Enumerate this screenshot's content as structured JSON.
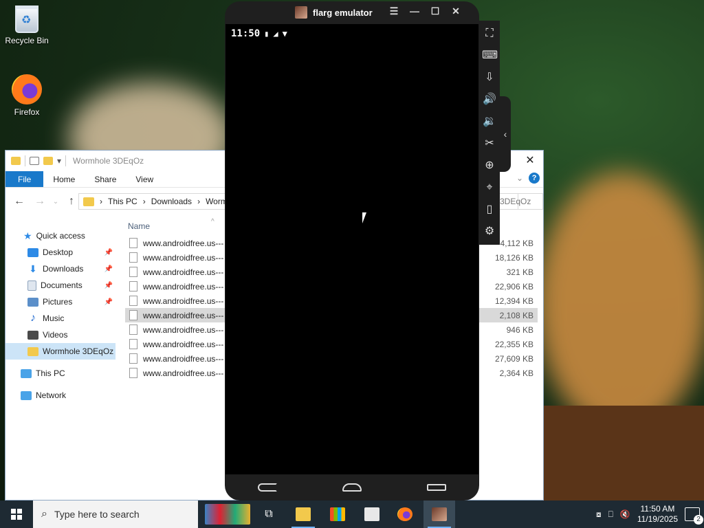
{
  "desktop": {
    "icons": [
      {
        "label": "Recycle Bin",
        "icon": "recycle-bin-icon"
      },
      {
        "label": "Firefox",
        "icon": "firefox-icon"
      }
    ]
  },
  "explorer": {
    "title": "Wormhole 3DEqOz",
    "ribbon_tabs": [
      "File",
      "Home",
      "Share",
      "View"
    ],
    "path": [
      "This PC",
      "Downloads",
      "Worm"
    ],
    "search_placeholder": "3DEqOz",
    "column_name": "Name",
    "nav": {
      "quick_access": "Quick access",
      "items": [
        {
          "label": "Desktop",
          "pinned": true,
          "color": "#2d8ae6"
        },
        {
          "label": "Downloads",
          "pinned": true,
          "color": "#2d8ae6"
        },
        {
          "label": "Documents",
          "pinned": true,
          "color": "#8da3bd"
        },
        {
          "label": "Pictures",
          "pinned": true,
          "color": "#5b8fc9"
        },
        {
          "label": "Music",
          "pinned": false,
          "color": "#2d72d2"
        },
        {
          "label": "Videos",
          "pinned": false,
          "color": "#4a4a4a"
        },
        {
          "label": "Wormhole 3DEqOz",
          "pinned": false,
          "color": "#f2c94c",
          "selected": true
        }
      ],
      "this_pc": "This PC",
      "network": "Network"
    },
    "files": [
      {
        "name": "www.androidfree.us---",
        "size": "4,112 KB"
      },
      {
        "name": "www.androidfree.us---",
        "size": "18,126 KB"
      },
      {
        "name": "www.androidfree.us---",
        "size": "321 KB"
      },
      {
        "name": "www.androidfree.us---",
        "size": "22,906 KB"
      },
      {
        "name": "www.androidfree.us---",
        "size": "12,394 KB"
      },
      {
        "name": "www.androidfree.us---",
        "size": "2,108 KB",
        "selected": true
      },
      {
        "name": "www.androidfree.us---",
        "size": "946 KB"
      },
      {
        "name": "www.androidfree.us---",
        "size": "22,355 KB"
      },
      {
        "name": "www.androidfree.us---",
        "size": "27,609 KB"
      },
      {
        "name": "www.androidfree.us---",
        "size": "2,364 KB"
      }
    ]
  },
  "emulator": {
    "title": "flarg emulator",
    "status_time": "11:50"
  },
  "taskbar": {
    "search_placeholder": "Type here to search",
    "time": "11:50 AM",
    "date": "11/19/2025",
    "notification_count": "2"
  },
  "colors": {
    "accent": "#1979ca",
    "taskbar": "#1e2a33",
    "emulator_frame": "#1f1f1f"
  }
}
